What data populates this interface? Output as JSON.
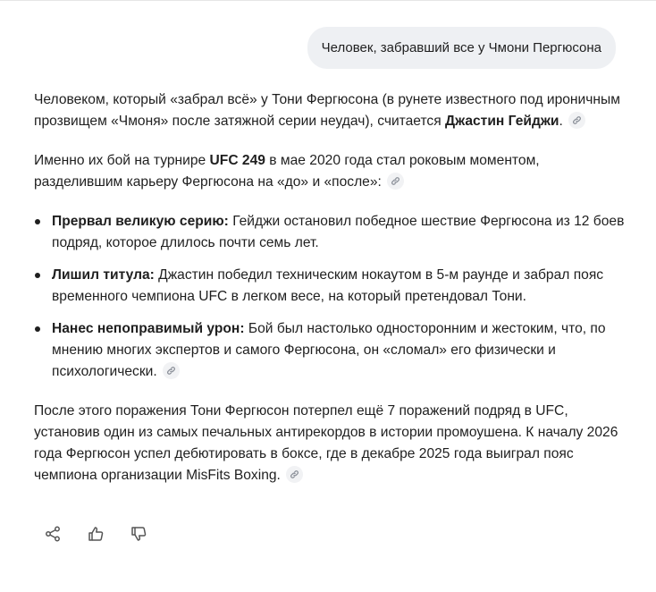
{
  "user_message": {
    "text": "Человек, забравший все у Чмони Пергюсона"
  },
  "answer": {
    "p1": {
      "t1": "Человеком, который «забрал всё» у Тони Фергюсона (в рунете известного под ироничным прозвищем «Чмоня» после затяжной серии неудач), считается ",
      "b1": "Джастин Гейджи",
      "t2": "."
    },
    "p2": {
      "t1": "Именно их бой на турнире ",
      "b1": "UFC 249",
      "t2": " в мае 2020 года стал роковым моментом, разделившим карьеру Фергюсона на «до» и «после»:"
    },
    "bullets": [
      {
        "title": "Прервал великую серию:",
        "text": " Гейджи остановил победное шествие Фергюсона из 12 боев подряд, которое длилось почти семь лет."
      },
      {
        "title": "Лишил титула:",
        "text": " Джастин победил техническим нокаутом в 5-м раунде и забрал пояс временного чемпиона UFC в легком весе, на который претендовал Тони."
      },
      {
        "title": "Нанес непоправимый урон:",
        "text": " Бой был настолько односторонним и жестоким, что, по мнению многих экспертов и самого Фергюсона, он «сломал» его физически и психологически."
      }
    ],
    "p3": {
      "t1": "После этого поражения Тони Фергюсон потерпел ещё 7 поражений подряд в UFC, установив один из самых печальных антирекордов в истории промоушена. К началу 2026 года Фергюсон успел дебютировать в боксе, где в декабре 2025 года выиграл пояс чемпиона организации MisFits Boxing."
    }
  },
  "actions": [
    {
      "icon": "share-icon"
    },
    {
      "icon": "thumbs-up-icon"
    },
    {
      "icon": "thumbs-down-icon"
    }
  ],
  "colors": {
    "text": "#1f1f1f",
    "bubble_bg": "#eef0f3",
    "link_chip_bg": "#f1f2f4",
    "icon": "#555555"
  }
}
